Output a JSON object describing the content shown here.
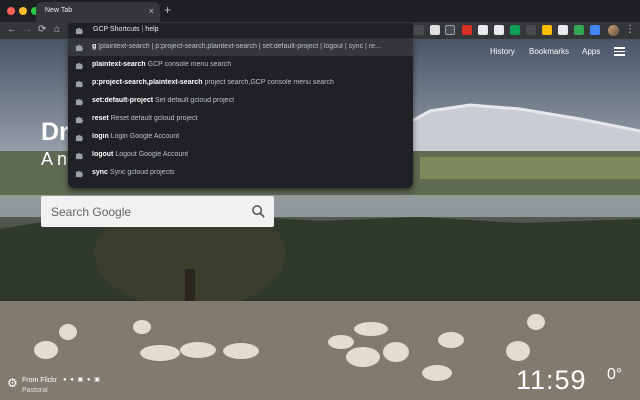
{
  "tab": {
    "title": "New Tab",
    "close": "×"
  },
  "newtab_label": "+",
  "nav": {
    "back": "←",
    "forward": "→",
    "reload": "⟳",
    "home": "⌂"
  },
  "omnibox": {
    "keyword": "GCP Shortcuts",
    "separator": "|",
    "query": "help"
  },
  "dropdown": [
    {
      "key": "g",
      "desc": "[plaintext-search | p:project-search,plaintext-search | set:default-project | logout | sync | re..."
    },
    {
      "key": "plaintext-search",
      "desc": "GCP console menu search"
    },
    {
      "key": "p:project-search,plaintext-search",
      "desc": "project search,GCP console menu search"
    },
    {
      "key": "set:default-project",
      "desc": "Set default gcloud project"
    },
    {
      "key": "reset",
      "desc": "Reset default gcloud project"
    },
    {
      "key": "login",
      "desc": "Login Google Account"
    },
    {
      "key": "logout",
      "desc": "Logout Google Account"
    },
    {
      "key": "sync",
      "desc": "Sync gcloud projects"
    }
  ],
  "links": {
    "history": "History",
    "bookmarks": "Bookmarks",
    "apps": "Apps"
  },
  "headline": "Dr",
  "subline": "A ne",
  "search": {
    "placeholder": "Search Google"
  },
  "footer": {
    "source": "From Flickr",
    "place": "Pastoral"
  },
  "clock": "11:59",
  "temperature": "0°",
  "icons": {
    "omnibox_ext": "puzzle-icon",
    "apps": "grid-icon",
    "settings": "gear-icon",
    "search": "search-icon"
  },
  "colors": {
    "chrome_bg": "#35363a",
    "dropdown_bg": "#202124",
    "selected_row": "#35363a"
  }
}
